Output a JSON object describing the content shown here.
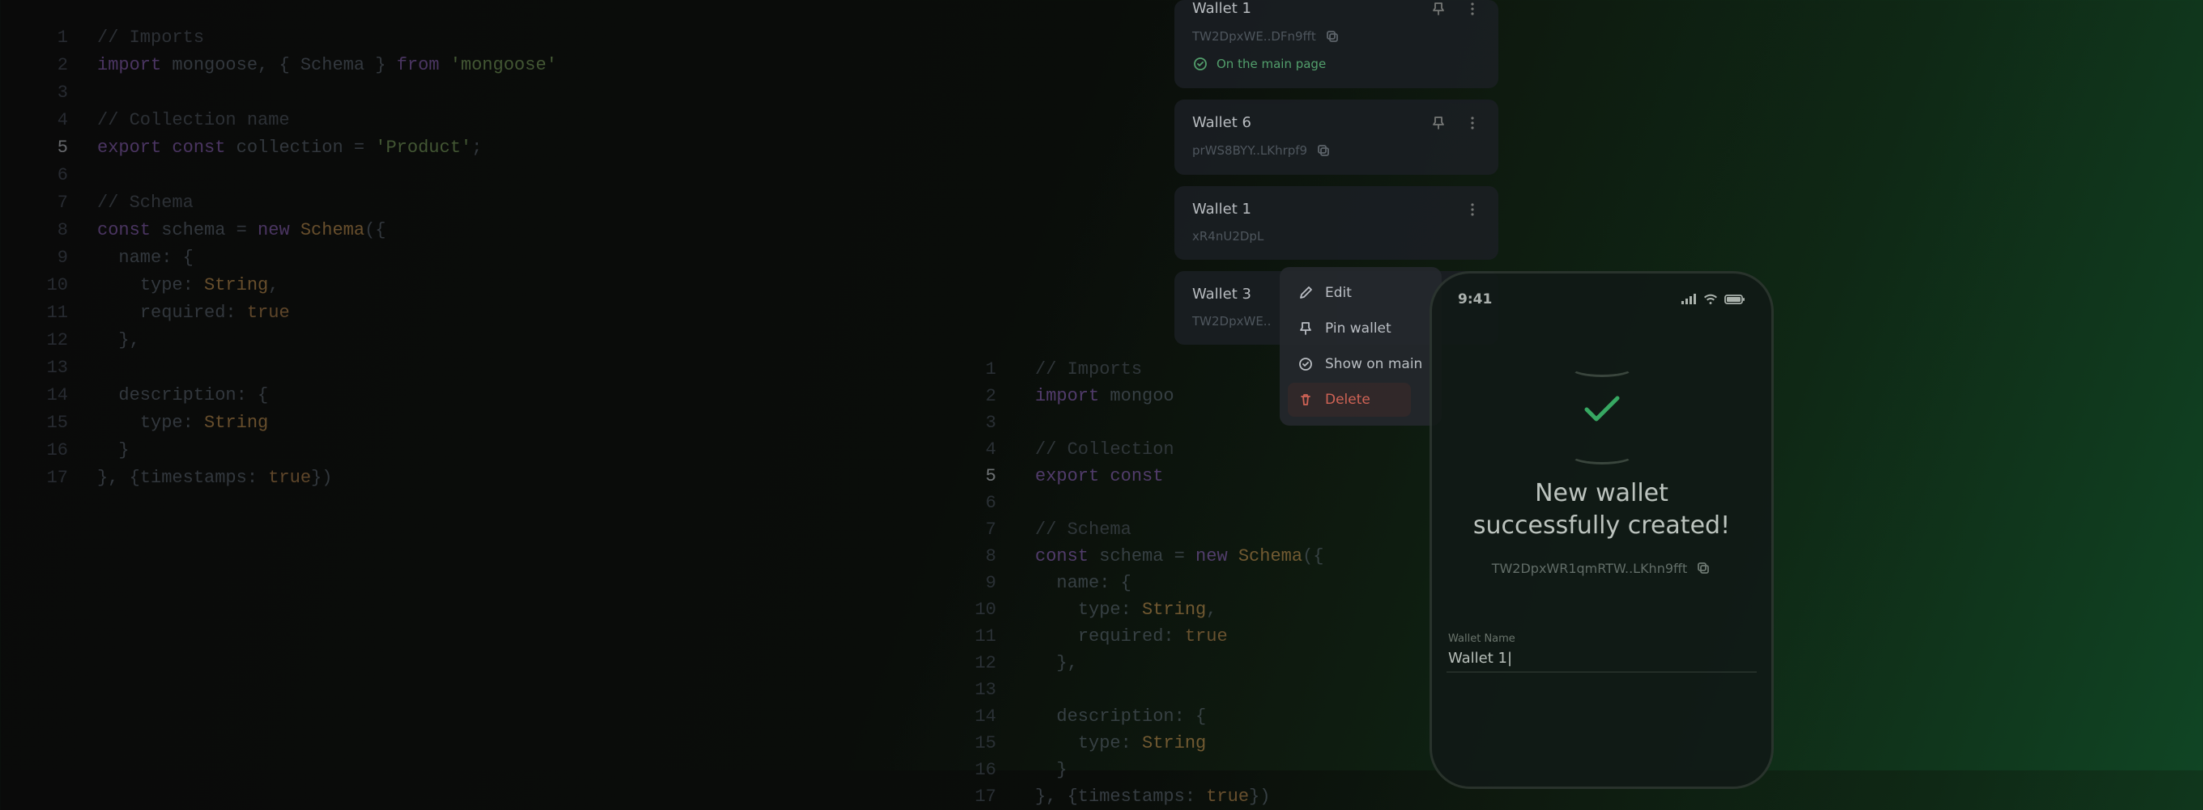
{
  "code": {
    "lines": [
      {
        "num": "1",
        "comment": "// Imports"
      },
      {
        "num": "2",
        "code_import": true
      },
      {
        "num": "3"
      },
      {
        "num": "4",
        "comment": "// Collection name"
      },
      {
        "num": "5",
        "code_collection": true,
        "current": true
      },
      {
        "num": "6"
      },
      {
        "num": "7",
        "comment": "// Schema"
      },
      {
        "num": "8",
        "schema_open": true
      },
      {
        "num": "9",
        "name_open": true
      },
      {
        "num": "10",
        "type_string": true
      },
      {
        "num": "11",
        "required_true": true
      },
      {
        "num": "12",
        "close_brace_comma": true
      },
      {
        "num": "13"
      },
      {
        "num": "14",
        "desc_open": true
      },
      {
        "num": "15",
        "type_string_nocomma": true
      },
      {
        "num": "16",
        "close_brace": true
      },
      {
        "num": "17",
        "timestamps": true
      }
    ],
    "import_mongoose": "import",
    "mongoose_name": "mongoose",
    "schema_name": "Schema",
    "from_kw": "from",
    "mongoose_str": "'mongoose'",
    "export_kw": "export",
    "const_kw": "const",
    "collection_var": "collection",
    "eq": "=",
    "product_str": "'Product'",
    "semi": ";",
    "schema_var": "schema",
    "new_kw": "new",
    "schema_cls": "Schema",
    "open_schema": "({",
    "name_key": "name:",
    "open_obj": "{",
    "type_key": "type:",
    "string_cls": "String",
    "comma": ",",
    "required_key": "required:",
    "true_val": "true",
    "close_obj_comma": "},",
    "desc_key": "description:",
    "close_obj": "}",
    "timestamps_full": "}, {timestamps: true})"
  },
  "wallets": [
    {
      "name": "Wallet 1",
      "addr": "TW2DpxWE..DFn9fft",
      "onMain": true,
      "onMainLabel": "On the main page",
      "showPin": true,
      "showMore": true
    },
    {
      "name": "Wallet 6",
      "addr": "prWS8BYY..LKhrpf9",
      "onMain": false,
      "showPin": true,
      "showMore": true
    },
    {
      "name": "Wallet 1",
      "addr": "xR4nU2DpL",
      "onMain": false,
      "showPin": false,
      "showMore": true
    },
    {
      "name": "Wallet 3",
      "addr": "TW2DpxWE..",
      "onMain": false,
      "showPin": false,
      "showMore": false
    }
  ],
  "menu": {
    "edit": "Edit",
    "pin": "Pin wallet",
    "show": "Show on main",
    "delete": "Delete"
  },
  "phone": {
    "time": "9:41",
    "heading1": "New wallet",
    "heading2": "successfully created!",
    "addr": "TW2DpxWR1qmRTW..LKhn9fft",
    "inputLabel": "Wallet Name",
    "inputValue": "Wallet 1|"
  }
}
